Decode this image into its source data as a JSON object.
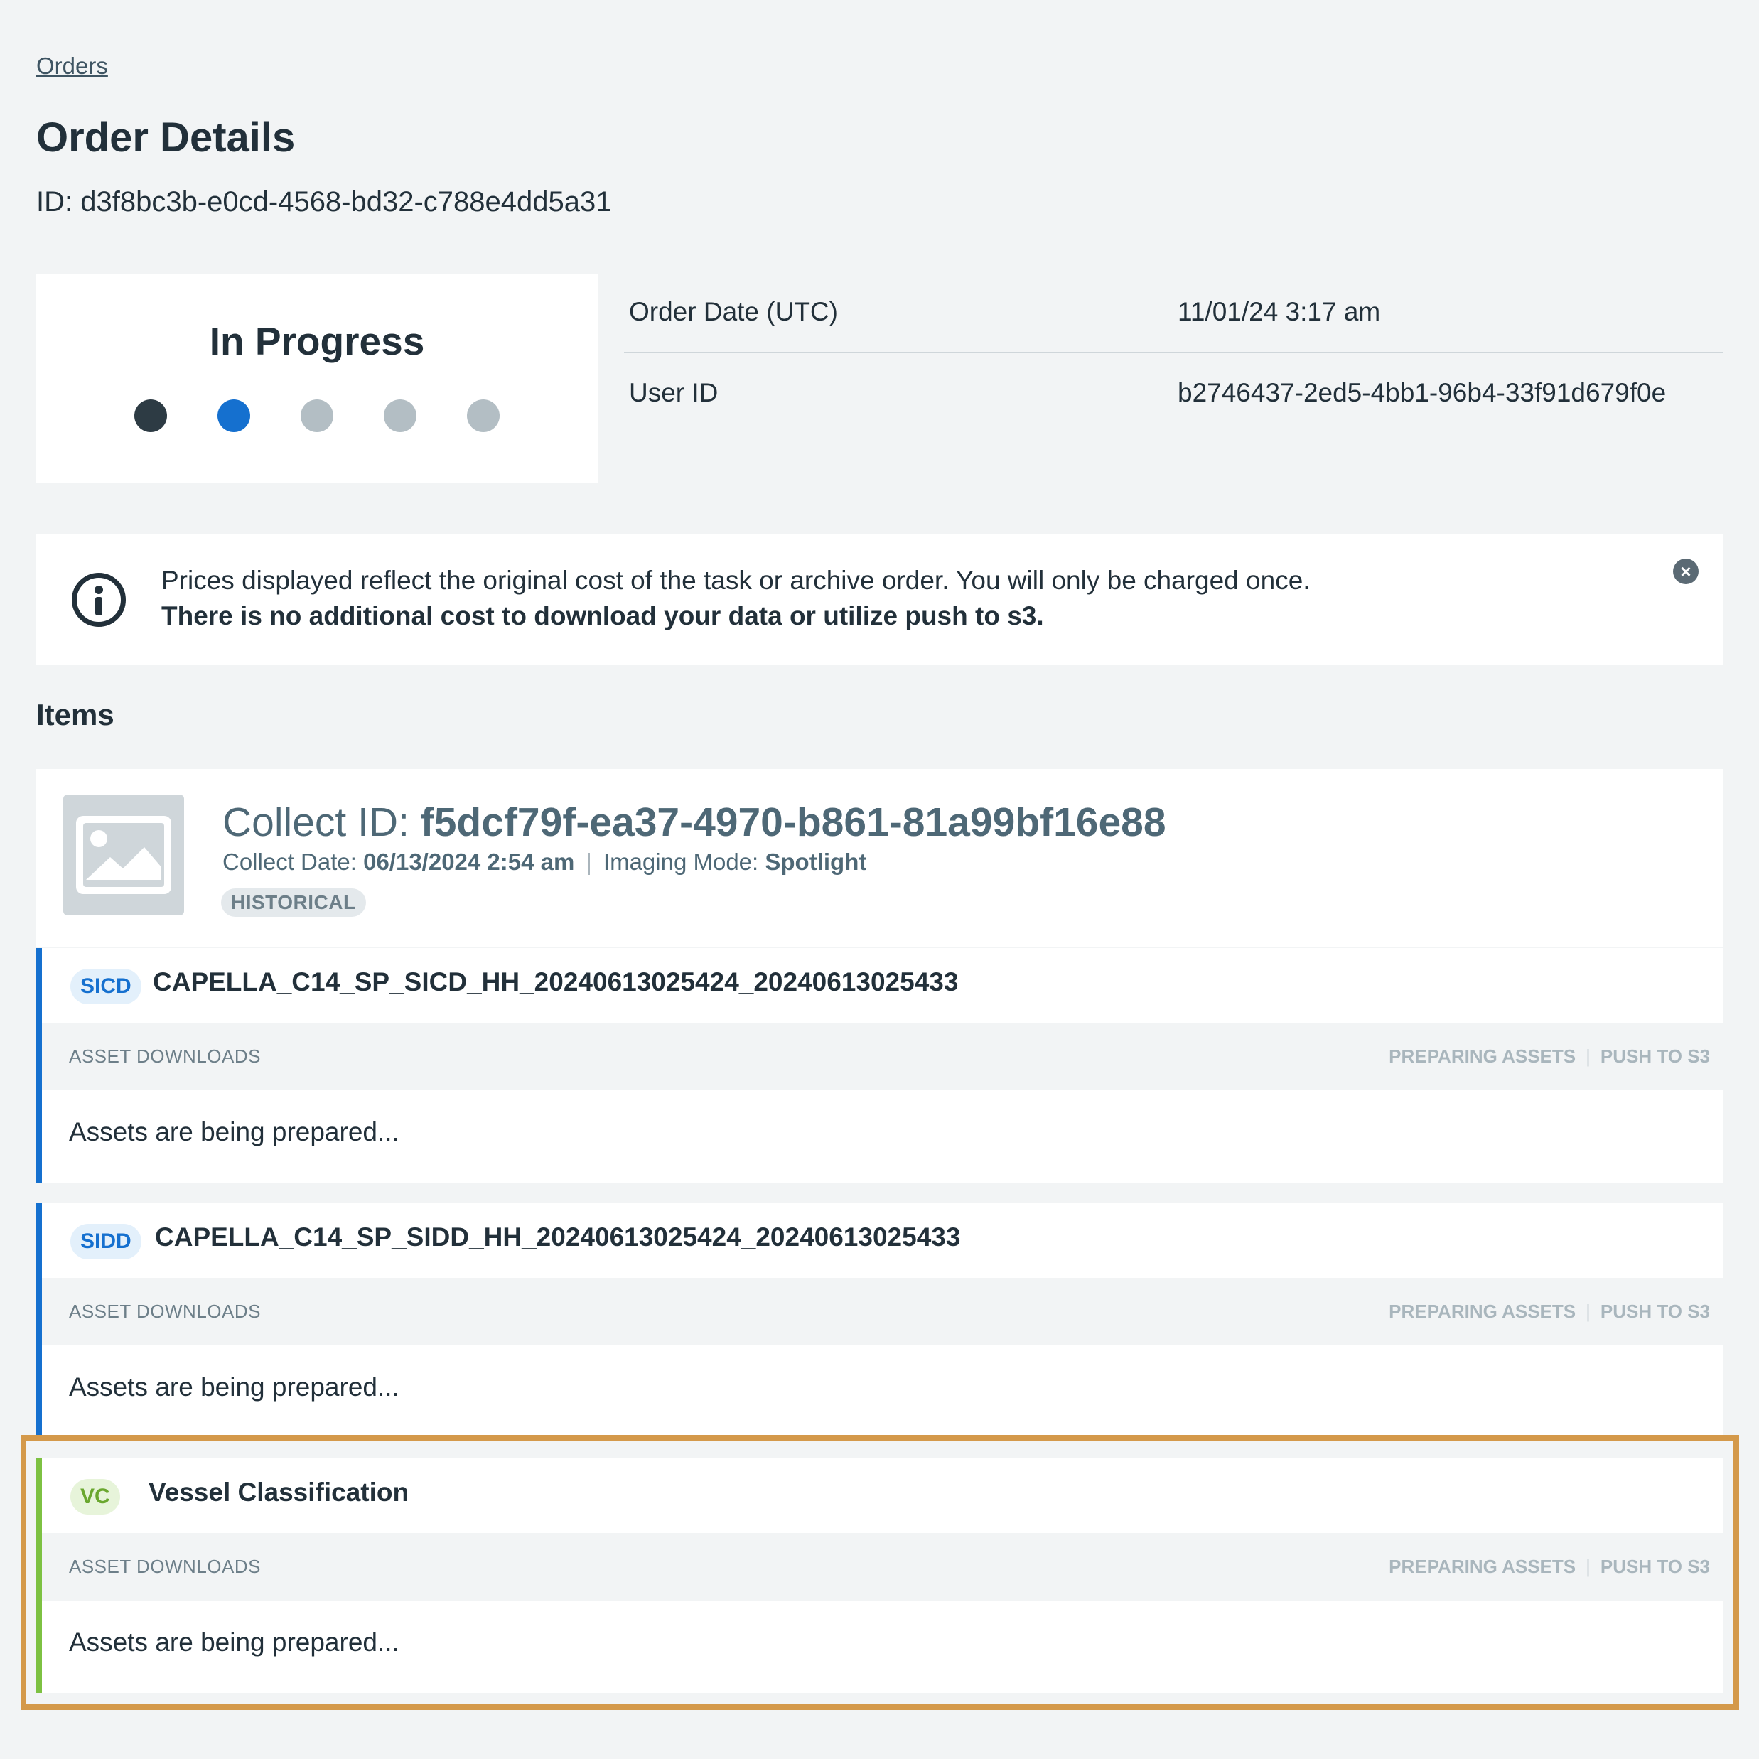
{
  "breadcrumb": {
    "orders_label": "Orders"
  },
  "header": {
    "title": "Order Details",
    "id_text": "ID: d3f8bc3b-e0cd-4568-bd32-c788e4dd5a31"
  },
  "status": {
    "label": "In Progress",
    "steps": [
      {
        "state": "complete",
        "color": "#2d3b44"
      },
      {
        "state": "current",
        "color": "#1570cf"
      },
      {
        "state": "pending",
        "color": "#b3bec4"
      },
      {
        "state": "pending",
        "color": "#b3bec4"
      },
      {
        "state": "pending",
        "color": "#b3bec4"
      }
    ]
  },
  "details": {
    "order_date_label": "Order Date (UTC)",
    "order_date_value": "11/01/24 3:17 am",
    "user_id_label": "User ID",
    "user_id_value": "b2746437-2ed5-4bb1-96b4-33f91d679f0e"
  },
  "notice": {
    "line1": "Prices displayed reflect the original cost of the task or archive order. You will only be charged once.",
    "line2": "There is no additional cost to download your data or utilize push to s3.",
    "close_icon": "×"
  },
  "items": {
    "heading": "Items",
    "collect": {
      "id_prefix": "Collect ID: ",
      "id_value": "f5dcf79f-ea37-4970-b861-81a99bf16e88",
      "date_label": "Collect Date: ",
      "date_value": "06/13/2024 2:54 am",
      "separator": "|",
      "mode_label": "Imaging Mode: ",
      "mode_value": "Spotlight",
      "badge": "HISTORICAL"
    },
    "products": [
      {
        "tag": "SICD",
        "name": "CAPELLA_C14_SP_SICD_HH_20240613025424_20240613025433",
        "downloads_label": "ASSET DOWNLOADS",
        "action_preparing": "PREPARING ASSETS",
        "action_push": "PUSH TO S3",
        "status_text": "Assets are being prepared..."
      },
      {
        "tag": "SIDD",
        "name": "CAPELLA_C14_SP_SIDD_HH_20240613025424_20240613025433",
        "downloads_label": "ASSET DOWNLOADS",
        "action_preparing": "PREPARING ASSETS",
        "action_push": "PUSH TO S3",
        "status_text": "Assets are being prepared..."
      },
      {
        "tag": "VC",
        "name": "Vessel Classification",
        "downloads_label": "ASSET DOWNLOADS",
        "action_preparing": "PREPARING ASSETS",
        "action_push": "PUSH TO S3",
        "status_text": "Assets are being prepared..."
      }
    ]
  },
  "colors": {
    "accent_blue": "#1570cf",
    "accent_green": "#7dc142",
    "highlight": "#d4994a"
  }
}
